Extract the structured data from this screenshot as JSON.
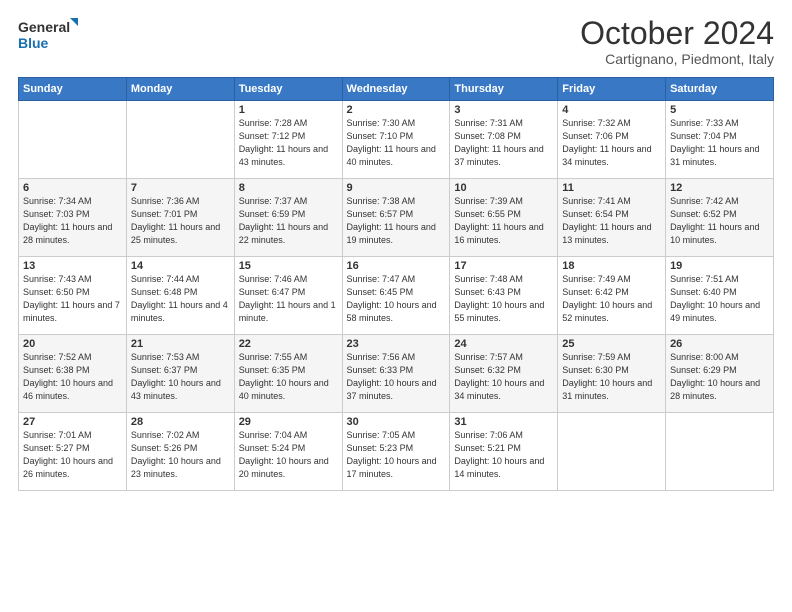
{
  "header": {
    "logo_line1": "General",
    "logo_line2": "Blue",
    "month": "October 2024",
    "location": "Cartignano, Piedmont, Italy"
  },
  "days_of_week": [
    "Sunday",
    "Monday",
    "Tuesday",
    "Wednesday",
    "Thursday",
    "Friday",
    "Saturday"
  ],
  "weeks": [
    [
      {
        "day": "",
        "info": ""
      },
      {
        "day": "",
        "info": ""
      },
      {
        "day": "1",
        "info": "Sunrise: 7:28 AM\nSunset: 7:12 PM\nDaylight: 11 hours and 43 minutes."
      },
      {
        "day": "2",
        "info": "Sunrise: 7:30 AM\nSunset: 7:10 PM\nDaylight: 11 hours and 40 minutes."
      },
      {
        "day": "3",
        "info": "Sunrise: 7:31 AM\nSunset: 7:08 PM\nDaylight: 11 hours and 37 minutes."
      },
      {
        "day": "4",
        "info": "Sunrise: 7:32 AM\nSunset: 7:06 PM\nDaylight: 11 hours and 34 minutes."
      },
      {
        "day": "5",
        "info": "Sunrise: 7:33 AM\nSunset: 7:04 PM\nDaylight: 11 hours and 31 minutes."
      }
    ],
    [
      {
        "day": "6",
        "info": "Sunrise: 7:34 AM\nSunset: 7:03 PM\nDaylight: 11 hours and 28 minutes."
      },
      {
        "day": "7",
        "info": "Sunrise: 7:36 AM\nSunset: 7:01 PM\nDaylight: 11 hours and 25 minutes."
      },
      {
        "day": "8",
        "info": "Sunrise: 7:37 AM\nSunset: 6:59 PM\nDaylight: 11 hours and 22 minutes."
      },
      {
        "day": "9",
        "info": "Sunrise: 7:38 AM\nSunset: 6:57 PM\nDaylight: 11 hours and 19 minutes."
      },
      {
        "day": "10",
        "info": "Sunrise: 7:39 AM\nSunset: 6:55 PM\nDaylight: 11 hours and 16 minutes."
      },
      {
        "day": "11",
        "info": "Sunrise: 7:41 AM\nSunset: 6:54 PM\nDaylight: 11 hours and 13 minutes."
      },
      {
        "day": "12",
        "info": "Sunrise: 7:42 AM\nSunset: 6:52 PM\nDaylight: 11 hours and 10 minutes."
      }
    ],
    [
      {
        "day": "13",
        "info": "Sunrise: 7:43 AM\nSunset: 6:50 PM\nDaylight: 11 hours and 7 minutes."
      },
      {
        "day": "14",
        "info": "Sunrise: 7:44 AM\nSunset: 6:48 PM\nDaylight: 11 hours and 4 minutes."
      },
      {
        "day": "15",
        "info": "Sunrise: 7:46 AM\nSunset: 6:47 PM\nDaylight: 11 hours and 1 minute."
      },
      {
        "day": "16",
        "info": "Sunrise: 7:47 AM\nSunset: 6:45 PM\nDaylight: 10 hours and 58 minutes."
      },
      {
        "day": "17",
        "info": "Sunrise: 7:48 AM\nSunset: 6:43 PM\nDaylight: 10 hours and 55 minutes."
      },
      {
        "day": "18",
        "info": "Sunrise: 7:49 AM\nSunset: 6:42 PM\nDaylight: 10 hours and 52 minutes."
      },
      {
        "day": "19",
        "info": "Sunrise: 7:51 AM\nSunset: 6:40 PM\nDaylight: 10 hours and 49 minutes."
      }
    ],
    [
      {
        "day": "20",
        "info": "Sunrise: 7:52 AM\nSunset: 6:38 PM\nDaylight: 10 hours and 46 minutes."
      },
      {
        "day": "21",
        "info": "Sunrise: 7:53 AM\nSunset: 6:37 PM\nDaylight: 10 hours and 43 minutes."
      },
      {
        "day": "22",
        "info": "Sunrise: 7:55 AM\nSunset: 6:35 PM\nDaylight: 10 hours and 40 minutes."
      },
      {
        "day": "23",
        "info": "Sunrise: 7:56 AM\nSunset: 6:33 PM\nDaylight: 10 hours and 37 minutes."
      },
      {
        "day": "24",
        "info": "Sunrise: 7:57 AM\nSunset: 6:32 PM\nDaylight: 10 hours and 34 minutes."
      },
      {
        "day": "25",
        "info": "Sunrise: 7:59 AM\nSunset: 6:30 PM\nDaylight: 10 hours and 31 minutes."
      },
      {
        "day": "26",
        "info": "Sunrise: 8:00 AM\nSunset: 6:29 PM\nDaylight: 10 hours and 28 minutes."
      }
    ],
    [
      {
        "day": "27",
        "info": "Sunrise: 7:01 AM\nSunset: 5:27 PM\nDaylight: 10 hours and 26 minutes."
      },
      {
        "day": "28",
        "info": "Sunrise: 7:02 AM\nSunset: 5:26 PM\nDaylight: 10 hours and 23 minutes."
      },
      {
        "day": "29",
        "info": "Sunrise: 7:04 AM\nSunset: 5:24 PM\nDaylight: 10 hours and 20 minutes."
      },
      {
        "day": "30",
        "info": "Sunrise: 7:05 AM\nSunset: 5:23 PM\nDaylight: 10 hours and 17 minutes."
      },
      {
        "day": "31",
        "info": "Sunrise: 7:06 AM\nSunset: 5:21 PM\nDaylight: 10 hours and 14 minutes."
      },
      {
        "day": "",
        "info": ""
      },
      {
        "day": "",
        "info": ""
      }
    ]
  ]
}
